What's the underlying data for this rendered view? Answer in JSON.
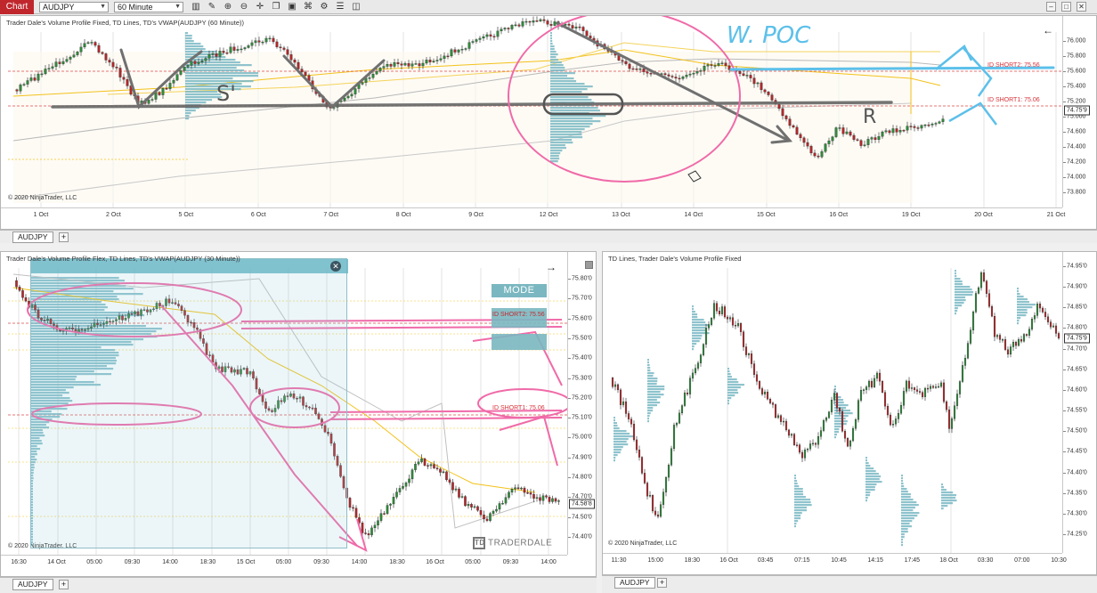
{
  "toolbar": {
    "chart_label": "Chart",
    "instrument": "AUDJPY",
    "interval": "60 Minute",
    "icons": [
      "bar-style-icon",
      "pencil-icon",
      "zoom-in-icon",
      "zoom-out-icon",
      "crosshair-icon",
      "copy-icon",
      "image-icon",
      "strategy-icon",
      "indicators-icon",
      "properties-icon",
      "overlay-icon",
      "list-icon"
    ]
  },
  "top_panel": {
    "title": "Trader Dale's Volume Profile Fixed, TD Lines, TD's VWAP(AUDJPY (60 Minute))",
    "copyright": "© 2020 NinjaTrader, LLC",
    "y_labels": [
      "76.000",
      "75.800",
      "75.600",
      "75.400",
      "75.200",
      "75.000",
      "74.600",
      "74.400",
      "74.200",
      "74.000",
      "73.800"
    ],
    "price_badge": "74.75'9",
    "x_labels": [
      "1 Oct",
      "2 Oct",
      "5 Oct",
      "6 Oct",
      "7 Oct",
      "8 Oct",
      "9 Oct",
      "12 Oct",
      "13 Oct",
      "14 Oct",
      "15 Oct",
      "16 Oct",
      "19 Oct",
      "20 Oct",
      "21 Oct"
    ],
    "level_short2": "ID SHORT2: 75.56",
    "level_short1": "ID SHORT1: 75.06",
    "tab": "AUDJPY",
    "tab_add": "+"
  },
  "left_panel": {
    "title": "Trader Dale's Volume Profile Flex, TD Lines, TD's VWAP(AUDJPY (30 Minute))",
    "copyright": "© 2020 NinjaTrader, LLC",
    "y_labels": [
      "75.80'0",
      "75.70'0",
      "75.60'0",
      "75.50'0",
      "75.40'0",
      "75.30'0",
      "75.20'0",
      "75.10'0",
      "75.00'0",
      "74.90'0",
      "74.80'0",
      "74.70'0",
      "74.50'0",
      "74.40'0"
    ],
    "price_badge": "74.58'8",
    "x_labels": [
      "16:30",
      "14 Oct",
      "05:00",
      "09:30",
      "14:00",
      "18:30",
      "15 Oct",
      "05:00",
      "09:30",
      "14:00",
      "18:30",
      "16 Oct",
      "05:00",
      "09:30",
      "14:00"
    ],
    "mode_label": "MODE",
    "level_short2": "ID SHORT2: 75.56",
    "level_short1": "ID SHORT1: 75.06",
    "brand": "TRADERDALE",
    "brand_mark": "TD",
    "tab": "AUDJPY",
    "tab_add": "+"
  },
  "right_panel": {
    "title": "TD Lines, Trader Dale's Volume Profile Fixed",
    "copyright": "© 2020 NinjaTrader, LLC",
    "y_labels": [
      "74.95'0",
      "74.90'0",
      "74.85'0",
      "74.80'0",
      "74.70'0",
      "74.65'0",
      "74.60'0",
      "74.55'0",
      "74.50'0",
      "74.45'0",
      "74.40'0",
      "74.35'0",
      "74.30'0",
      "74.25'0"
    ],
    "price_badge": "74.75'9",
    "x_labels": [
      "11:30",
      "15:00",
      "18:30",
      "16 Oct",
      "03:45",
      "07:15",
      "10:45",
      "14:15",
      "17:45",
      "18 Oct",
      "03:30",
      "07:00",
      "10:30"
    ],
    "tab": "AUDJPY",
    "tab_add": "+"
  },
  "annotations": {
    "top_note_poc": "W. POC",
    "top_note_s": "S'",
    "top_note_r": "R",
    "colors": {
      "pink": "#f06aa8",
      "blue": "#5cc0ea",
      "gray": "#707070"
    }
  },
  "colors": {
    "bull": "#2e8b3a",
    "bear": "#b3262a",
    "profile": "#7ab8c4",
    "vwap": "#f2c21a",
    "level": "#e04a4a"
  }
}
